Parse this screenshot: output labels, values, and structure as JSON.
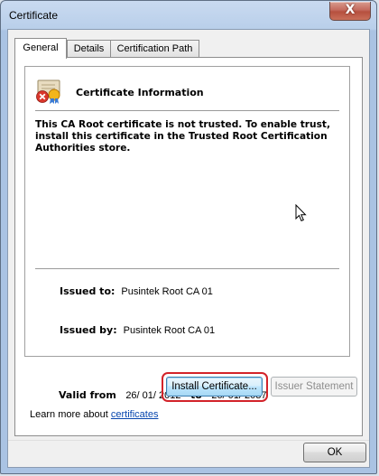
{
  "window": {
    "title": "Certificate",
    "close_label": "X"
  },
  "tabs": [
    {
      "label": "General",
      "active": true
    },
    {
      "label": "Details",
      "active": false
    },
    {
      "label": "Certification Path",
      "active": false
    }
  ],
  "info": {
    "title": "Certificate Information",
    "warning": "This CA Root certificate is not trusted. To enable trust, install this certificate in the Trusted Root Certification Authorities store."
  },
  "fields": {
    "issued_to_label": "Issued to:",
    "issued_to_value": "Pusintek Root CA 01",
    "issued_by_label": "Issued by:",
    "issued_by_value": "Pusintek Root CA 01",
    "valid_from_label": "Valid from",
    "valid_from_value": "26/ 01/ 2012",
    "valid_to_label": "to",
    "valid_to_value": "26/ 01/ 2037"
  },
  "buttons": {
    "install": "Install Certificate...",
    "issuer_statement": "Issuer Statement",
    "ok": "OK"
  },
  "learn_more": {
    "prefix": "Learn more about ",
    "link": "certificates"
  },
  "colors": {
    "highlight": "#d3232a",
    "link": "#0645ad"
  }
}
